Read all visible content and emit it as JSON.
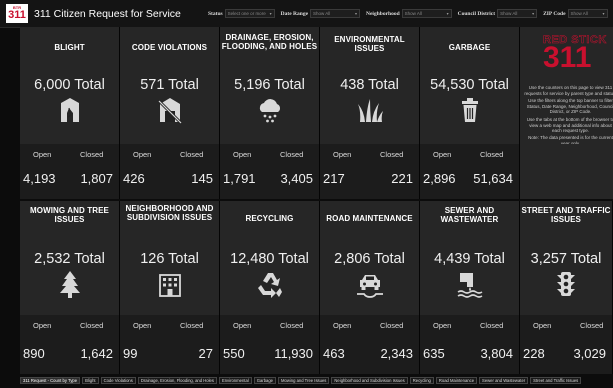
{
  "app": {
    "logo_line1": "BTR",
    "logo_line2": "311",
    "title": "311 Citizen Request for Service"
  },
  "filters": [
    {
      "label": "Status",
      "placeholder": "Select one or more",
      "width": 50
    },
    {
      "label": "Date Range",
      "placeholder": "Show All",
      "width": 50
    },
    {
      "label": "Neighborhood",
      "placeholder": "Show All",
      "width": 50
    },
    {
      "label": "Council District",
      "placeholder": "Show All",
      "width": 40
    },
    {
      "label": "ZIP Code",
      "placeholder": "Show All",
      "width": 40
    }
  ],
  "common": {
    "open_label": "Open",
    "closed_label": "Closed"
  },
  "categories": [
    {
      "title": "BLIGHT",
      "total": "6,000 Total",
      "open": "4,193",
      "closed": "1,807",
      "icon": "blight-icon"
    },
    {
      "title": "CODE VIOLATIONS",
      "total": "571 Total",
      "open": "426",
      "closed": "145",
      "icon": "code-violations-icon"
    },
    {
      "title": "DRAINAGE, EROSION, FLOODING, AND HOLES",
      "total": "5,196 Total",
      "open": "1,791",
      "closed": "3,405",
      "icon": "rain-cloud-icon"
    },
    {
      "title": "ENVIRONMENTAL ISSUES",
      "total": "438 Total",
      "open": "217",
      "closed": "221",
      "icon": "grass-icon"
    },
    {
      "title": "GARBAGE",
      "total": "54,530 Total",
      "open": "2,896",
      "closed": "51,634",
      "icon": "trash-can-icon"
    },
    {
      "title": "MOWING AND TREE ISSUES",
      "total": "2,532 Total",
      "open": "890",
      "closed": "1,642",
      "icon": "tree-icon"
    },
    {
      "title": "NEIGHBORHOOD AND SUBDIVISION ISSUES",
      "total": "126 Total",
      "open": "99",
      "closed": "27",
      "icon": "building-icon"
    },
    {
      "title": "RECYCLING",
      "total": "12,480 Total",
      "open": "550",
      "closed": "11,930",
      "icon": "recycle-icon"
    },
    {
      "title": "ROAD MAINTENANCE",
      "total": "2,806 Total",
      "open": "463",
      "closed": "2,343",
      "icon": "car-pothole-icon"
    },
    {
      "title": "SEWER AND WASTEWATER",
      "total": "4,439 Total",
      "open": "635",
      "closed": "3,804",
      "icon": "sewer-icon"
    },
    {
      "title": "STREET AND TRAFFIC ISSUES",
      "total": "3,257 Total",
      "open": "228",
      "closed": "3,029",
      "icon": "traffic-light-icon"
    }
  ],
  "info": {
    "brand_line1": "RED STICK",
    "brand_line2": "311",
    "p1": "Use the counters on this page to view 311 requests for service by parent type and status.",
    "p2": "Use the filters along the top banner to filter Status, Date Range, Neighborhood, Council District, or ZIP Code.",
    "p3": "Use the tabs at the bottom of the browser to view a web map and additional info about each request type.",
    "p4": "Note: The data presented is for the current year only."
  },
  "tabs": [
    "311 Request - Count by Type",
    "Blight",
    "Code Violations",
    "Drainage, Erosion, Flooding, and Holes",
    "Environmental",
    "Garbage",
    "Mowing and Tree Issues",
    "Neighborhood and Subdivision Issues",
    "Recycling",
    "Road Maintenance",
    "Sewer and Wastewater",
    "Street and Traffic Issues"
  ],
  "colors": {
    "accent": "#c8102e",
    "panel_top": "#262626",
    "panel_bottom": "#1c1c1c",
    "background": "#0c0c0c"
  }
}
